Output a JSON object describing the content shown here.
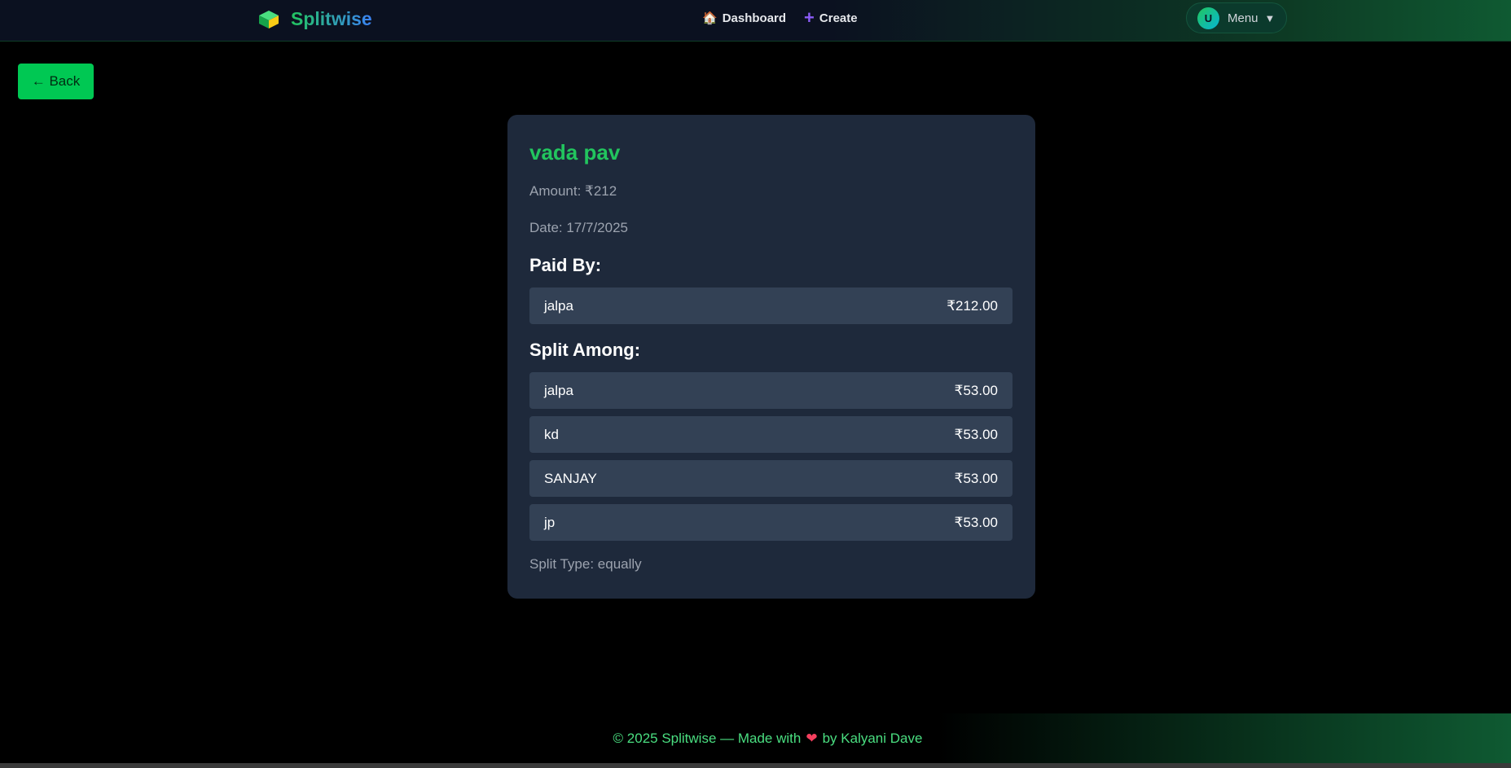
{
  "nav": {
    "brand": "Splitwise",
    "links": [
      {
        "icon": "🏠",
        "label": "Dashboard"
      },
      {
        "icon": "+",
        "label": "Create"
      }
    ],
    "avatar_initial": "U",
    "menu_label": "Menu",
    "menu_caret": "▼"
  },
  "back_label": "← Back",
  "expense": {
    "title": "vada pav",
    "amount_text": "Amount: ₹212",
    "date_text": "Date: 17/7/2025",
    "paid_by_heading": "Paid By:",
    "paid_by": [
      {
        "name": "jalpa",
        "amount": "₹212.00"
      }
    ],
    "split_heading": "Split Among:",
    "split": [
      {
        "name": "jalpa",
        "amount": "₹53.00"
      },
      {
        "name": "kd",
        "amount": "₹53.00"
      },
      {
        "name": "SANJAY",
        "amount": "₹53.00"
      },
      {
        "name": "jp",
        "amount": "₹53.00"
      }
    ],
    "split_type_text": "Split Type: equally"
  },
  "footer": {
    "before": "© 2025 Splitwise — Made with",
    "heart": "❤",
    "after": "by Kalyani Dave"
  },
  "colors": {
    "accent_green": "#22c55e",
    "button_green": "#00c853",
    "card_bg": "#1e293b",
    "row_bg": "#334155"
  }
}
